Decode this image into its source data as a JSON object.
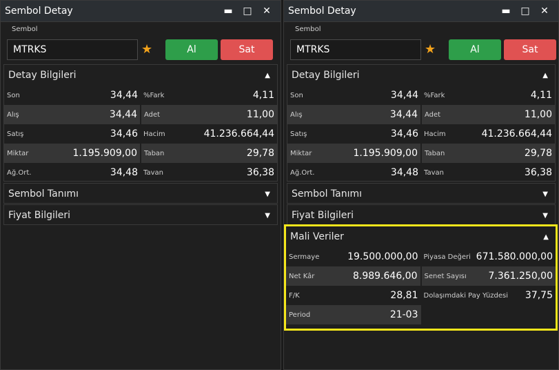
{
  "window_title": "Sembol Detay",
  "controls": {
    "minimize": "▬",
    "maximize": "□",
    "close": "✕"
  },
  "sembol_label": "Sembol",
  "sembol_value": "MTRKS",
  "buy_label": "Al",
  "sell_label": "Sat",
  "detay": {
    "title": "Detay Bilgileri",
    "rows": [
      {
        "l1": "Son",
        "v1": "34,44",
        "l2": "%Fark",
        "v2": "4,11"
      },
      {
        "l1": "Alış",
        "v1": "34,44",
        "l2": "Adet",
        "v2": "11,00"
      },
      {
        "l1": "Satış",
        "v1": "34,46",
        "l2": "Hacim",
        "v2": "41.236.664,44"
      },
      {
        "l1": "Miktar",
        "v1": "1.195.909,00",
        "l2": "Taban",
        "v2": "29,78"
      },
      {
        "l1": "Ağ.Ort.",
        "v1": "34,48",
        "l2": "Tavan",
        "v2": "36,38"
      }
    ]
  },
  "sembol_tanimi": "Sembol Tanımı",
  "fiyat_bilgileri": "Fiyat Bilgileri",
  "mali": {
    "title": "Mali Veriler",
    "rows": [
      {
        "l1": "Sermaye",
        "v1": "19.500.000,00",
        "l2": "Piyasa Değeri",
        "v2": "671.580.000,00"
      },
      {
        "l1": "Net Kâr",
        "v1": "8.989.646,00",
        "l2": "Senet Sayısı",
        "v2": "7.361.250,00"
      },
      {
        "l1": "F/K",
        "v1": "28,81",
        "l2": "Dolaşımdaki Pay Yüzdesi",
        "v2": "37,75"
      },
      {
        "l1": "Period",
        "v1": "21-03",
        "l2": "",
        "v2": ""
      }
    ]
  },
  "colors": {
    "buy": "#2e9e4a",
    "sell": "#e05252",
    "star": "#f2a21b",
    "highlight": "#f5e61b"
  }
}
